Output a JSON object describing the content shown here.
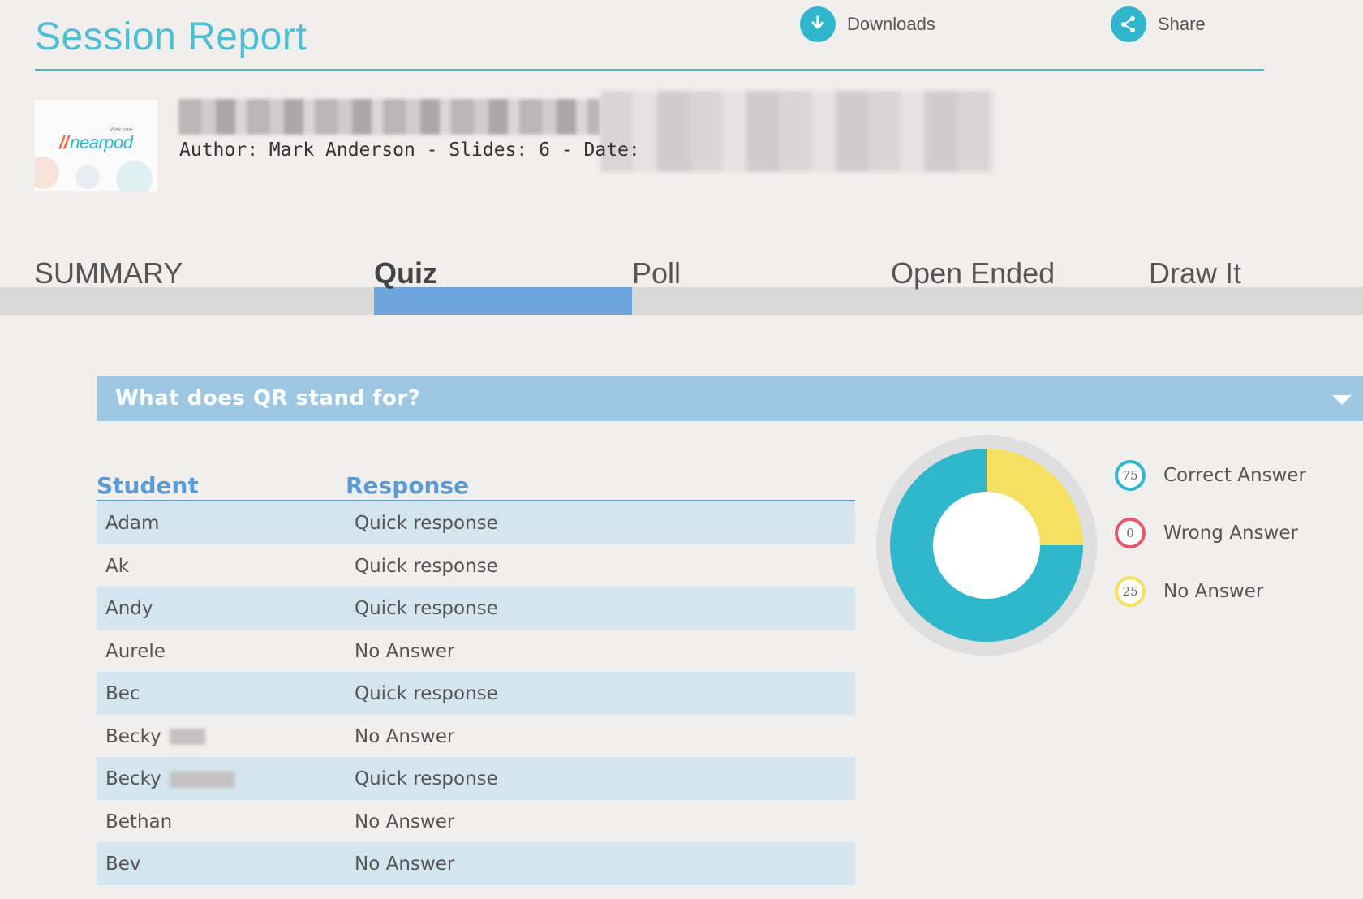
{
  "header": {
    "title": "Session Report",
    "downloads_label": "Downloads",
    "share_label": "Share"
  },
  "lesson": {
    "thumbnail_welcome": "Welcome",
    "thumbnail_logo": "nearpod",
    "author_line": "Author: Mark Anderson - Slides: 6 - Date:"
  },
  "tabs": [
    {
      "label": "SUMMARY",
      "active": false
    },
    {
      "label": "Quiz",
      "active": true
    },
    {
      "label": "Poll",
      "active": false
    },
    {
      "label": "Open Ended",
      "active": false
    },
    {
      "label": "Draw It",
      "active": false
    }
  ],
  "question": {
    "text": "What does QR stand for?"
  },
  "table": {
    "headers": {
      "student": "Student",
      "response": "Response"
    },
    "rows": [
      {
        "student": "Adam",
        "response": "Quick response"
      },
      {
        "student": "Ak",
        "response": "Quick response"
      },
      {
        "student": "Andy",
        "response": "Quick response"
      },
      {
        "student": "Aurele",
        "response": "No Answer"
      },
      {
        "student": "Bec",
        "response": "Quick response"
      },
      {
        "student": "Becky",
        "response": "No Answer"
      },
      {
        "student": "Becky",
        "response": "Quick response"
      },
      {
        "student": "Bethan",
        "response": "No Answer"
      },
      {
        "student": "Bev",
        "response": "No Answer"
      }
    ]
  },
  "chart_data": {
    "type": "pie",
    "categories": [
      "Correct Answer",
      "Wrong Answer",
      "No Answer"
    ],
    "values": [
      75,
      0,
      25
    ],
    "colors": [
      "#2fb8cc",
      "#e8576b",
      "#f5e062"
    ]
  },
  "legend": [
    {
      "value": "75",
      "label": "Correct Answer",
      "color": "#2fb8cc"
    },
    {
      "value": "0",
      "label": "Wrong Answer",
      "color": "#e8576b"
    },
    {
      "value": "25",
      "label": "No Answer",
      "color": "#f5e062"
    }
  ]
}
